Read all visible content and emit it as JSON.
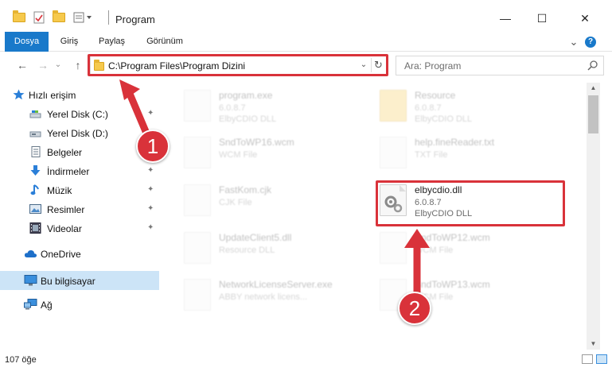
{
  "window": {
    "title": "Program",
    "minimize": "—",
    "maximize": "☐",
    "close": "✕"
  },
  "ribbon": {
    "tabs": [
      {
        "label": "Dosya",
        "active": true
      },
      {
        "label": "Giriş",
        "active": false
      },
      {
        "label": "Paylaş",
        "active": false
      },
      {
        "label": "Görünüm",
        "active": false
      }
    ],
    "expand": "⌄",
    "help": "?"
  },
  "address": {
    "path": "C:\\Program Files\\Program Dizini",
    "dropdown": "⌄",
    "refresh": "↻"
  },
  "search": {
    "placeholder": "Ara: Program"
  },
  "nav": {
    "back": "←",
    "forward": "→",
    "recent": "⌄",
    "up": "↑"
  },
  "sidebar": {
    "items": [
      {
        "label": "Hızlı erişim",
        "icon": "star-icon"
      },
      {
        "label": "Yerel Disk (C:)",
        "icon": "drive-icon",
        "pinned": true
      },
      {
        "label": "Yerel Disk (D:)",
        "icon": "drive-icon"
      },
      {
        "label": "Belgeler",
        "icon": "documents-icon"
      },
      {
        "label": "İndirmeler",
        "icon": "download-icon",
        "pinned": true
      },
      {
        "label": "Müzik",
        "icon": "music-icon",
        "pinned": true
      },
      {
        "label": "Resimler",
        "icon": "pictures-icon",
        "pinned": true
      },
      {
        "label": "Videolar",
        "icon": "video-icon",
        "pinned": true
      },
      {
        "label": "OneDrive",
        "icon": "cloud-icon"
      },
      {
        "label": "Bu bilgisayar",
        "icon": "computer-icon",
        "selected": true
      },
      {
        "label": "Ağ",
        "icon": "network-icon"
      }
    ],
    "pin_glyph": "📌"
  },
  "files": [
    {
      "name": "program.exe",
      "line1": "6.0.8.7",
      "line2": "ElbyCDIO DLL",
      "kind": "exe"
    },
    {
      "name": "Resource",
      "line1": "6.0.8.7",
      "line2": "ElbyCDIO DLL",
      "kind": "folder"
    },
    {
      "name": "SndToWP16.wcm",
      "line1": "WCM File",
      "line2": "",
      "kind": "doc"
    },
    {
      "name": "help.fineReader.txt",
      "line1": "TXT File",
      "line2": "",
      "kind": "doc"
    },
    {
      "name": "FastKom.cjk",
      "line1": "CJK File",
      "line2": "",
      "kind": "doc"
    },
    {
      "name": "elbycdio.dll",
      "line1": "6.0.8.7",
      "line2": "ElbyCDIO DLL",
      "kind": "dll",
      "highlighted": true
    },
    {
      "name": "UpdateClient5.dll",
      "line1": "Resource DLL",
      "line2": "",
      "kind": "dll"
    },
    {
      "name": "SndToWP12.wcm",
      "line1": "WCM File",
      "line2": "",
      "kind": "doc"
    },
    {
      "name": "NetworkLicenseServer.exe",
      "line1": "ABBY network licens...",
      "line2": "",
      "kind": "exe"
    },
    {
      "name": "SndToWP13.wcm",
      "line1": "WCM File",
      "line2": "",
      "kind": "doc"
    }
  ],
  "status": {
    "count": "107 öğe"
  },
  "callouts": [
    {
      "number": "1"
    },
    {
      "number": "2"
    }
  ],
  "colors": {
    "accent": "#1979ca",
    "highlight_red": "#d9323a",
    "selected_bg": "#cce4f7"
  }
}
